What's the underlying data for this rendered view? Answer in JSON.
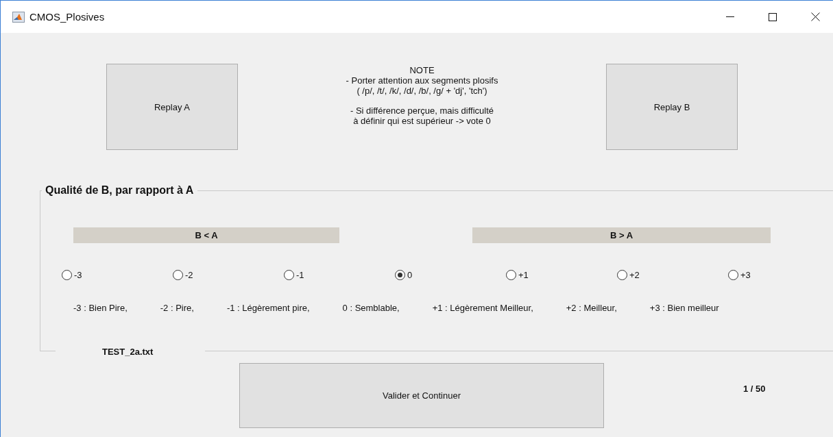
{
  "window": {
    "title": "CMOS_Plosives"
  },
  "replay_a": {
    "label": "Replay A"
  },
  "note_blocks": [
    {
      "lines": [
        "NOTE",
        "- Porter attention aux segments plosifs",
        "( /p/, /t/, /k/, /d/, /b/, /g/ + 'dj', 'tch')"
      ]
    },
    {
      "lines": [
        "- Si différence perçue, mais difficulté",
        "à définir qui est supérieur -> vote 0"
      ]
    }
  ],
  "replay_b": {
    "label": "Replay B"
  },
  "panel": {
    "title": "Qualité de B, par rapport à A",
    "groups": [
      {
        "label": "B < A"
      },
      {
        "label": "B > A"
      }
    ],
    "options": [
      {
        "label": "-3",
        "selected": false
      },
      {
        "label": "-2",
        "selected": false
      },
      {
        "label": "-1",
        "selected": false
      },
      {
        "label": "0",
        "selected": true
      },
      {
        "label": "+1",
        "selected": false
      },
      {
        "label": "+2",
        "selected": false
      },
      {
        "label": "+3",
        "selected": false
      }
    ],
    "legend": [
      "-3 : Bien Pire,",
      "-2 : Pire,",
      "-1 : Légèrement pire,",
      "0 : Semblable,",
      "+1 : Légèrement Meilleur,",
      "+2 : Meilleur,",
      "+3 : Bien meilleur"
    ],
    "caption": "TEST_2a.txt"
  },
  "continue_button": {
    "label": "Valider et Continuer"
  },
  "counter": "1 / 50"
}
